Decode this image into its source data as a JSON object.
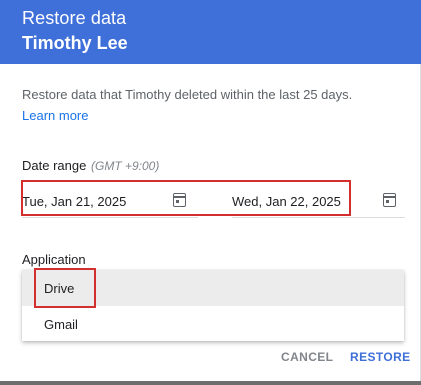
{
  "dialog": {
    "title": "Restore data",
    "user_name": "Timothy Lee",
    "description": "Restore data that Timothy deleted within the last 25 days.",
    "learn_more": "Learn more"
  },
  "date_range": {
    "label": "Date range",
    "timezone": "(GMT +9:00)",
    "start": "Tue, Jan 21, 2025",
    "end": "Wed, Jan 22, 2025",
    "start_icon": "calendar-icon",
    "end_icon": "calendar-icon"
  },
  "application": {
    "label": "Application",
    "options": [
      "Drive",
      "Gmail"
    ],
    "selected": "Drive"
  },
  "actions": {
    "cancel": "CANCEL",
    "restore": "RESTORE"
  },
  "colors": {
    "header": "#3f6fd8",
    "link": "#1a73e8",
    "highlight": "#d32f2f"
  }
}
